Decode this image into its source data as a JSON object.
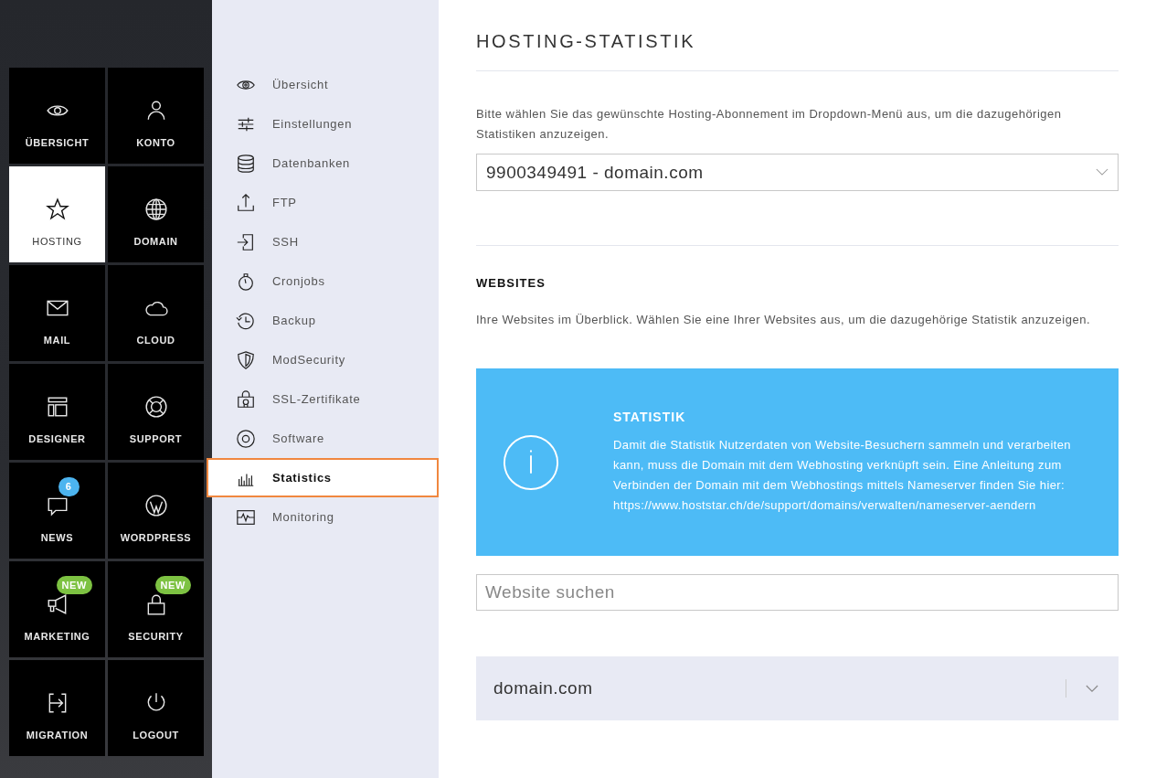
{
  "tiles": [
    {
      "label": "ÜBERSICHT",
      "selected": false
    },
    {
      "label": "KONTO",
      "selected": false
    },
    {
      "label": "HOSTING",
      "selected": true
    },
    {
      "label": "DOMAIN",
      "selected": false
    },
    {
      "label": "MAIL",
      "selected": false
    },
    {
      "label": "CLOUD",
      "selected": false
    },
    {
      "label": "DESIGNER",
      "selected": false
    },
    {
      "label": "SUPPORT",
      "selected": false
    },
    {
      "label": "NEWS",
      "selected": false,
      "badge": {
        "kind": "count",
        "text": "6"
      }
    },
    {
      "label": "WORDPRESS",
      "selected": false
    },
    {
      "label": "MARKETING",
      "selected": false,
      "badge": {
        "kind": "new",
        "text": "NEW"
      }
    },
    {
      "label": "SECURITY",
      "selected": false,
      "badge": {
        "kind": "new",
        "text": "NEW"
      }
    },
    {
      "label": "MIGRATION",
      "selected": false
    },
    {
      "label": "LOGOUT",
      "selected": false
    }
  ],
  "subnav": [
    {
      "label": "Übersicht",
      "selected": false
    },
    {
      "label": "Einstellungen",
      "selected": false
    },
    {
      "label": "Datenbanken",
      "selected": false
    },
    {
      "label": "FTP",
      "selected": false
    },
    {
      "label": "SSH",
      "selected": false
    },
    {
      "label": "Cronjobs",
      "selected": false
    },
    {
      "label": "Backup",
      "selected": false
    },
    {
      "label": "ModSecurity",
      "selected": false
    },
    {
      "label": "SSL-Zertifikate",
      "selected": false
    },
    {
      "label": "Software",
      "selected": false
    },
    {
      "label": "Statistics",
      "selected": true
    },
    {
      "label": "Monitoring",
      "selected": false
    }
  ],
  "main": {
    "title": "HOSTING-STATISTIK",
    "intro": "Bitte wählen Sie das gewünschte Hosting-Abonnement im Dropdown-Menü aus, um die dazugehörigen Statistiken anzuzeigen.",
    "subscription_select": {
      "value": "9900349491 - domain.com"
    },
    "websites_heading": "WEBSITES",
    "websites_text": "Ihre Websites im Überblick. Wählen Sie eine Ihrer Websites aus, um die dazugehörige Statistik anzuzeigen.",
    "info": {
      "title": "STATISTIK",
      "text": "Damit die Statistik Nutzerdaten von Website-Besuchern sammeln und verarbeiten kann, muss die Domain mit dem Webhosting verknüpft sein. Eine Anleitung zum Verbinden der Domain mit dem Webhostings mittels Nameserver finden Sie hier: https://www.hoststar.ch/de/support/domains/verwalten/nameserver-aendern"
    },
    "search": {
      "placeholder": "Website suchen"
    },
    "websites": [
      {
        "name": "domain.com",
        "expanded": false
      }
    ]
  }
}
